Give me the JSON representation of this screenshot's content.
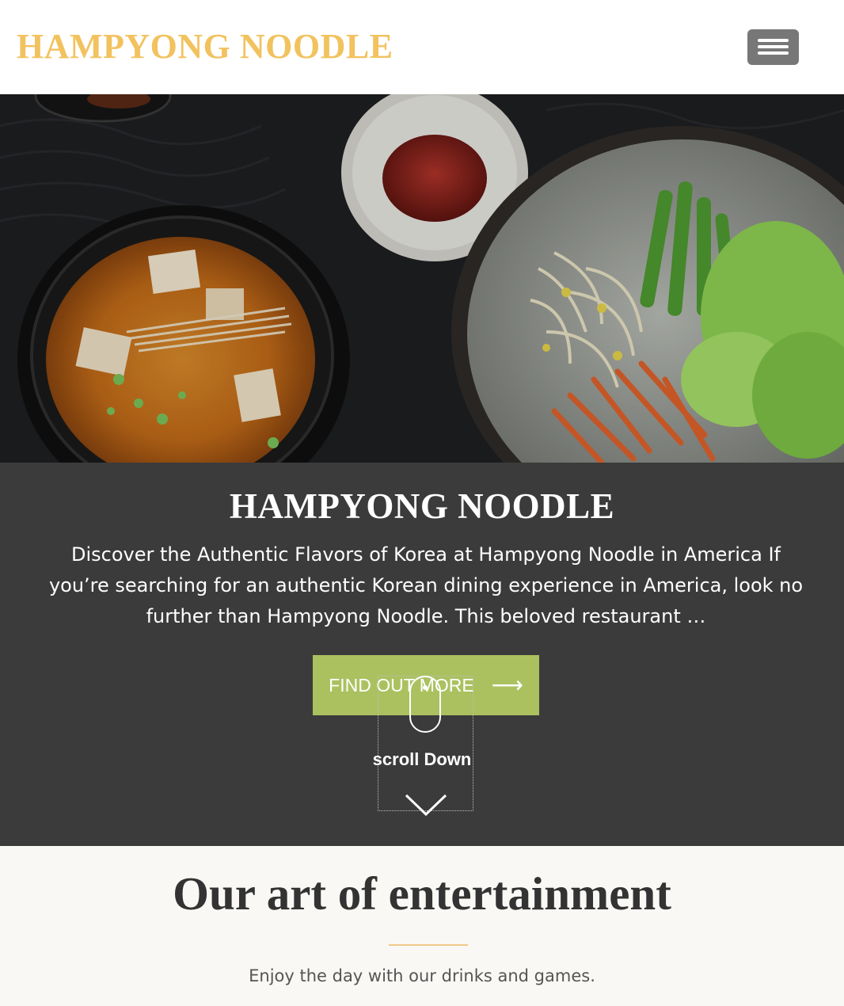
{
  "header": {
    "brand": "HAMPYONG NOODLE",
    "menu_icon": "hamburger-menu-icon"
  },
  "hero": {
    "image_subject": "Korean tofu stew, red pepper paste and cold noodles with vegetables",
    "title": "HAMPYONG NOODLE",
    "description": "Discover the Authentic Flavors of Korea at Hampyong Noodle in America If you’re searching for an authentic Korean dining experience in America, look no further than Hampyong Noodle. This beloved restaurant …",
    "cta_label": "FIND OUT MORE",
    "cta_icon": "arrow-right-icon",
    "scroll_label": "scroll Down",
    "scroll_icon": "mouse-icon",
    "chevron_icon": "chevron-down-icon"
  },
  "section": {
    "title": "Our art of entertainment",
    "subtitle": "Enjoy the day with our drinks and games."
  },
  "colors": {
    "brand_gold": "#f2c25e",
    "panel_dark": "#3b3b3b",
    "cta_green": "#abc160",
    "menu_gray": "#777777",
    "section_bg": "#faf8f5",
    "divider_gold": "#f2c98a"
  }
}
